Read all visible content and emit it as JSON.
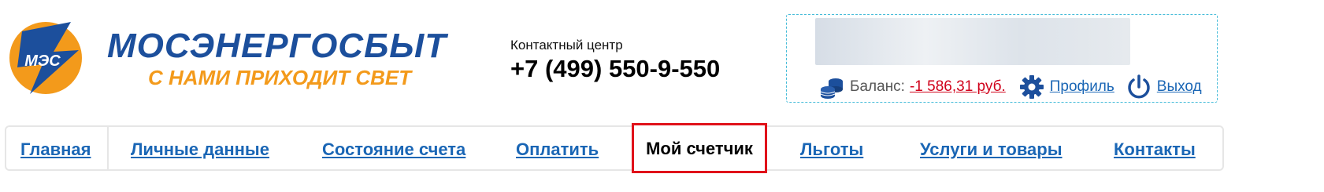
{
  "brand": {
    "emblem_text": "МЭС",
    "name": "МОСЭНЕРГОСБЫТ",
    "slogan": "С НАМИ ПРИХОДИТ СВЕТ"
  },
  "contact": {
    "label": "Контактный центр",
    "phone": "+7 (499) 550-9-550"
  },
  "user": {
    "balance_label": "Баланс:",
    "balance_value": " -1 586,31 руб.",
    "profile_label": "Профиль",
    "logout_label": "Выход"
  },
  "nav": {
    "items": [
      {
        "label": "Главная"
      },
      {
        "label": "Личные данные"
      },
      {
        "label": "Состояние счета"
      },
      {
        "label": "Оплатить"
      },
      {
        "label": "Мой счетчик"
      },
      {
        "label": "Льготы"
      },
      {
        "label": "Услуги и товары"
      },
      {
        "label": "Контакты"
      }
    ],
    "active_index": 4
  },
  "colors": {
    "brand_blue": "#1c4f9c",
    "brand_orange": "#f39a1b",
    "link_blue": "#1a66b5",
    "balance_red": "#d0021b",
    "highlight_red": "#e0121a"
  }
}
